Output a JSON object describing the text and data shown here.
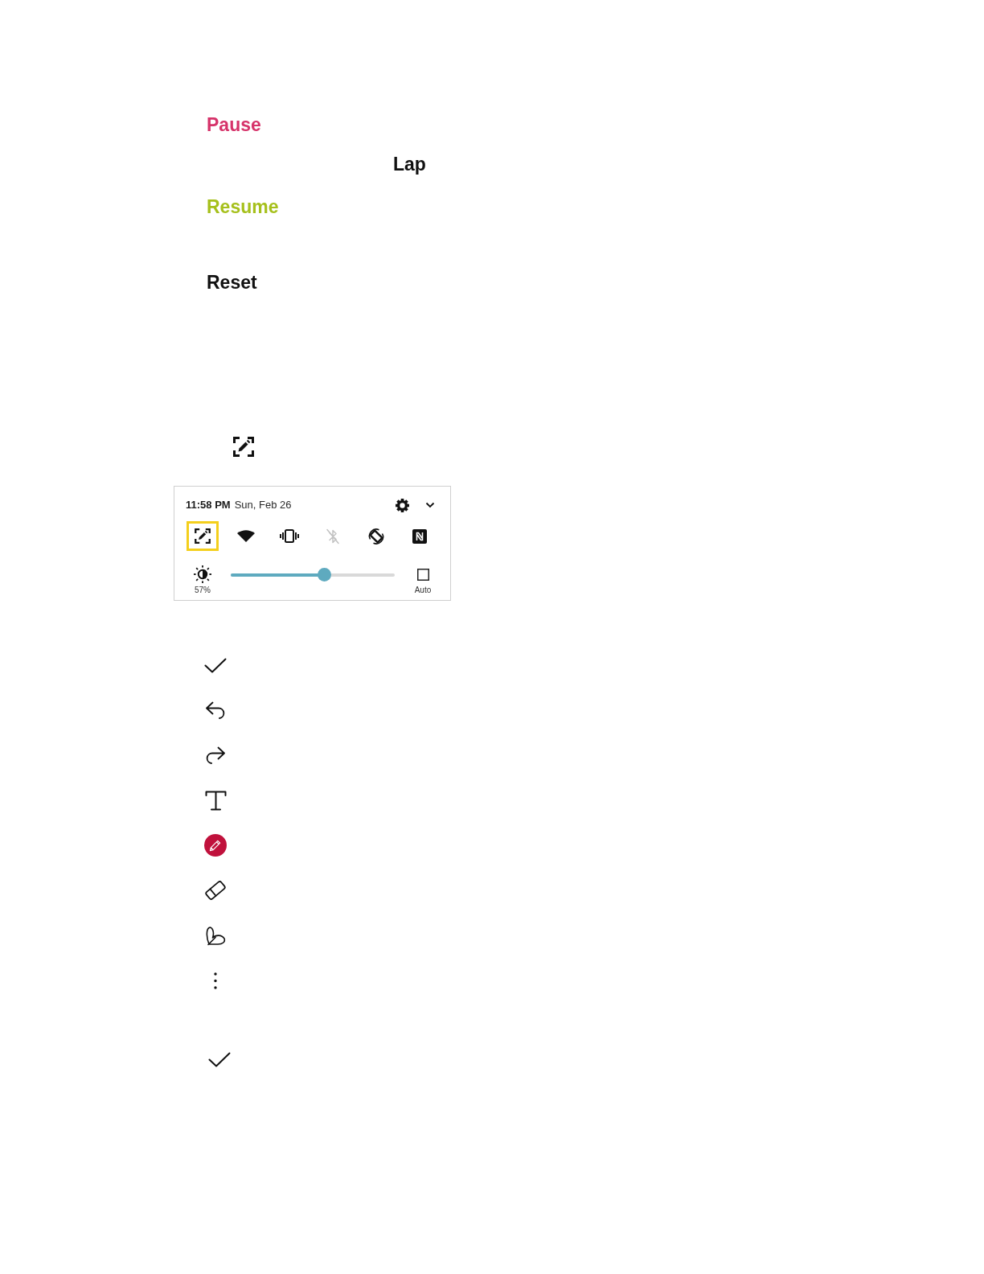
{
  "actions": [
    {
      "label": "Pause",
      "color": "#d6336a"
    },
    {
      "label": "Lap",
      "color": "#111111"
    },
    {
      "label": "Resume",
      "color": "#a6c01c"
    },
    {
      "label": "Reset",
      "color": "#111111"
    }
  ],
  "quick_panel": {
    "time": "11:58 PM",
    "date": "Sun, Feb 26",
    "tiles": [
      {
        "selected": true,
        "on": true
      },
      {
        "selected": false,
        "on": true
      },
      {
        "selected": false,
        "on": true
      },
      {
        "selected": false,
        "on": false
      },
      {
        "selected": false,
        "on": true
      },
      {
        "selected": false,
        "on": true
      }
    ],
    "brightness": {
      "level": 0.57,
      "reading": "57%"
    },
    "auto_brightness": {
      "label": "Auto",
      "checked": false
    }
  },
  "tools": [
    {
      "selected": false
    },
    {
      "selected": false
    },
    {
      "selected": false
    },
    {
      "selected": false
    },
    {
      "selected": true
    },
    {
      "selected": false
    },
    {
      "selected": false
    },
    {
      "selected": false
    }
  ]
}
